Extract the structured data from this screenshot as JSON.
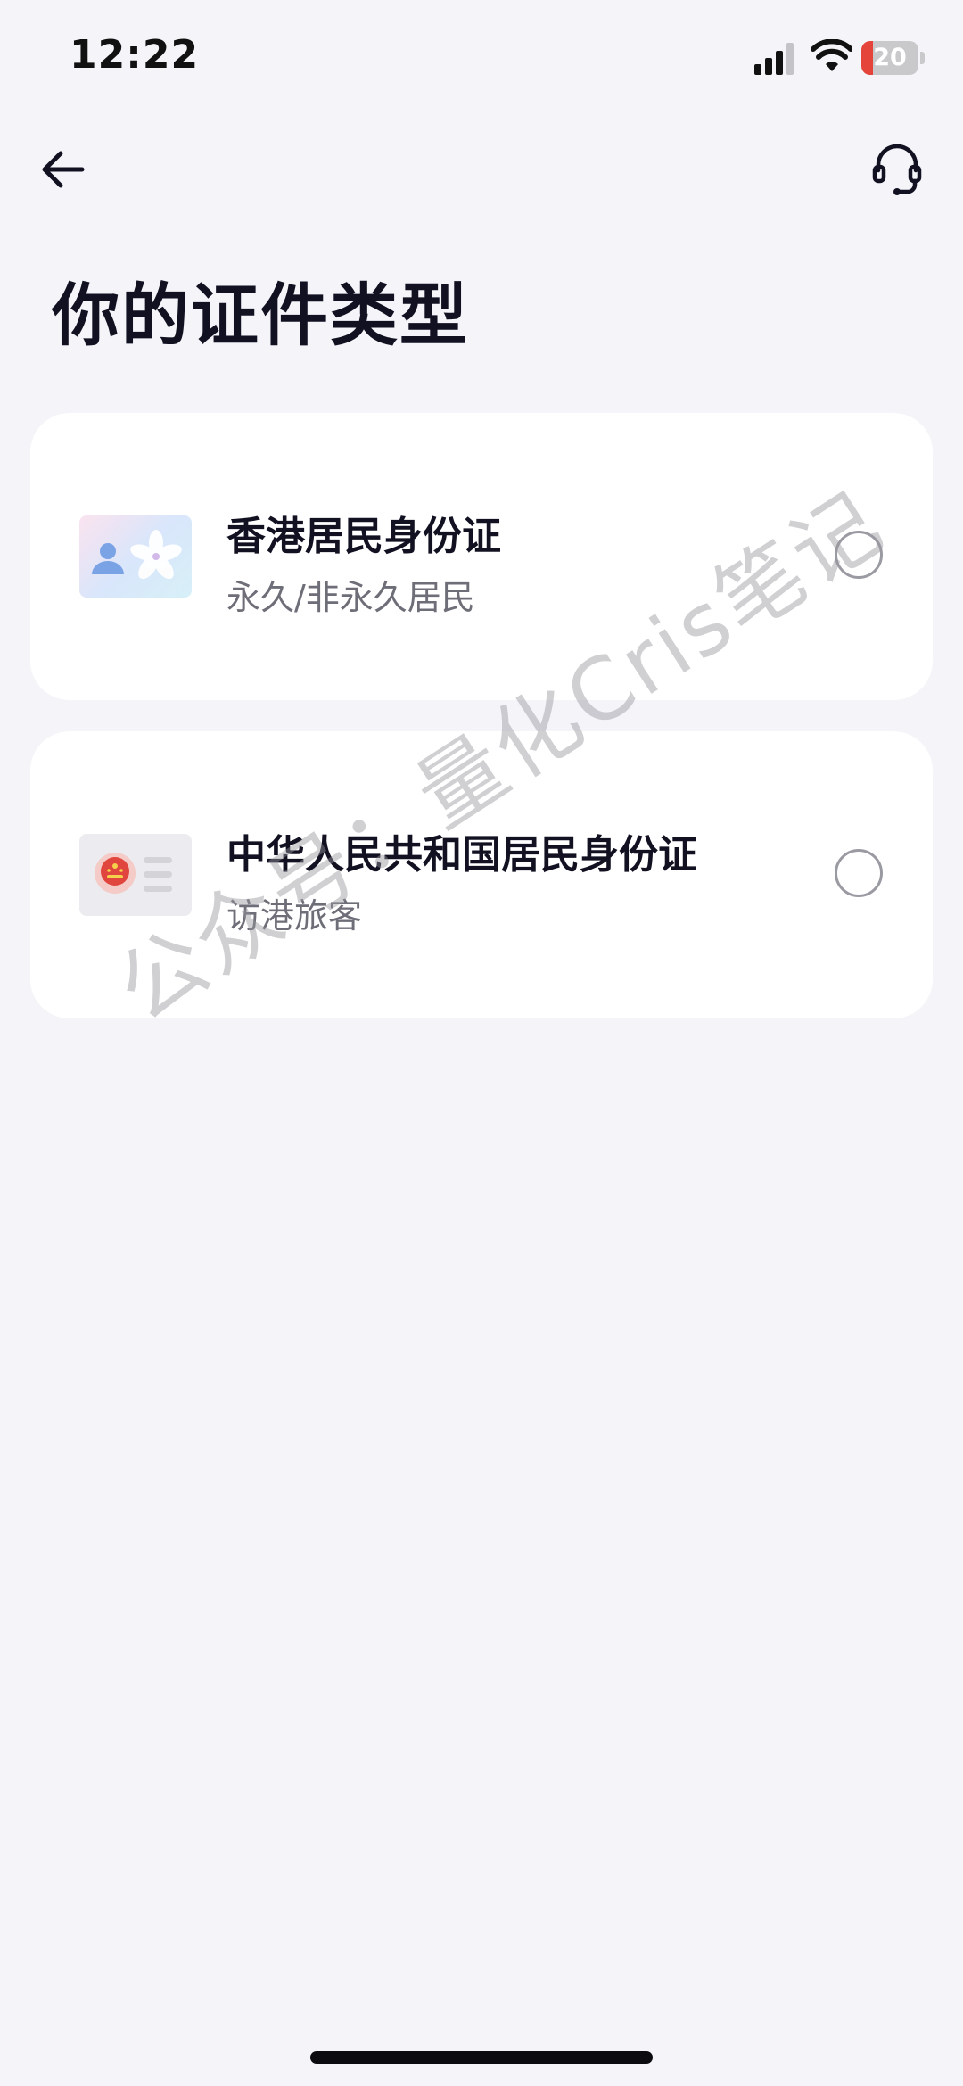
{
  "status_bar": {
    "time": "12:22",
    "battery_level": "20",
    "battery_percent": 20,
    "battery_color": "#e5443a",
    "signal_icon": "cellular-signal-icon",
    "wifi_icon": "wifi-icon"
  },
  "nav": {
    "back_icon": "arrow-left-icon",
    "support_icon": "headset-icon"
  },
  "page": {
    "title": "你的证件类型"
  },
  "options": [
    {
      "title": "香港居民身份证",
      "subtitle": "永久/非永久居民",
      "icon": "hk-id-card-icon",
      "selected": false
    },
    {
      "title": "中华人民共和国居民身份证",
      "subtitle": "访港旅客",
      "icon": "prc-id-card-icon",
      "selected": false
    }
  ],
  "watermark": {
    "text": "公众号：量化Cris笔记"
  },
  "colors": {
    "background": "#f4f4f9",
    "card": "#ffffff",
    "text_primary": "#111122",
    "text_secondary": "#6e6e78"
  }
}
